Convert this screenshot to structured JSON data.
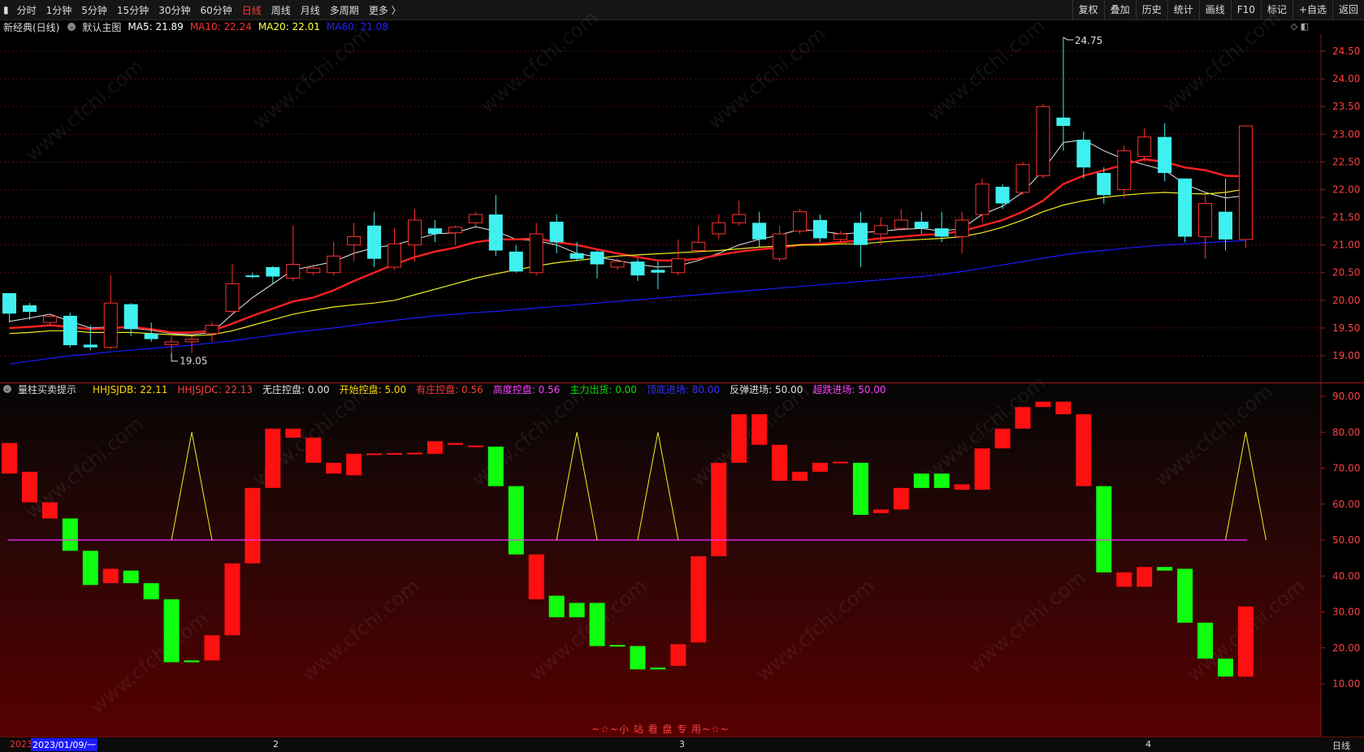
{
  "toolbar": {
    "periods": [
      "分时",
      "1分钟",
      "5分钟",
      "15分钟",
      "30分钟",
      "60分钟",
      "日线",
      "周线",
      "月线",
      "多周期",
      "更多 〉"
    ],
    "active_period": "日线",
    "right_buttons": [
      "复权",
      "叠加",
      "历史",
      "统计",
      "画线",
      "F10",
      "标记",
      "+自选",
      "返回"
    ]
  },
  "main_legend": {
    "name": "新经典(日线)",
    "template": "默认主图",
    "ma5": "MA5: 21.89",
    "ma10": "MA10: 22.24",
    "ma20": "MA20: 22.01",
    "ma60": "MA60: 21.08"
  },
  "main_axis": {
    "ticks": [
      "24.50",
      "24.00",
      "23.50",
      "23.00",
      "22.50",
      "22.00",
      "21.50",
      "21.00",
      "20.50",
      "20.00",
      "19.50",
      "19.00"
    ]
  },
  "annotations": {
    "high": "24.75",
    "low": "19.05"
  },
  "sub_legend": {
    "name": "量柱买卖提示",
    "items": [
      {
        "text": "HHJSJDB: 22.11",
        "color": "#ffd700"
      },
      {
        "text": "HHJSJDC: 22.13",
        "color": "#ff3c3c"
      },
      {
        "text": "无庄控盘: 0.00",
        "color": "#e0e0e0"
      },
      {
        "text": "开始控盘: 5.00",
        "color": "#ffd700"
      },
      {
        "text": "有庄控盘: 0.56",
        "color": "#ff3c3c"
      },
      {
        "text": "高度控盘: 0.56",
        "color": "#ff40ff"
      },
      {
        "text": "主力出货: 0.00",
        "color": "#00e000"
      },
      {
        "text": "顶底进场: 80.00",
        "color": "#3030ff"
      },
      {
        "text": "反弹进场: 50.00",
        "color": "#e0e0e0"
      },
      {
        "text": "超跌进场: 50.00",
        "color": "#ff40ff"
      }
    ]
  },
  "sub_axis": {
    "ticks": [
      "90.00",
      "80.00",
      "70.00",
      "60.00",
      "50.00",
      "40.00",
      "30.00",
      "20.00",
      "10.00"
    ]
  },
  "watermark": "www.cfchi.com",
  "footer_note": "~☆~小 站 看 盘 专 用~☆~",
  "xaxis": {
    "year_prefix": "2023",
    "cursor_date": "2023/01/09/一",
    "month_labels": [
      "2",
      "3",
      "4"
    ],
    "period_label": "日线"
  },
  "chart_data": {
    "type": "candlestick",
    "price_ylim": [
      18.8,
      24.85
    ],
    "candles": [
      {
        "o": 20.13,
        "c": 19.76,
        "h": 20.13,
        "l": 19.6
      },
      {
        "o": 19.91,
        "c": 19.79,
        "h": 19.95,
        "l": 19.65
      },
      {
        "o": 19.6,
        "c": 19.71,
        "h": 19.75,
        "l": 19.55
      },
      {
        "o": 19.72,
        "c": 19.19,
        "h": 19.78,
        "l": 19.15
      },
      {
        "o": 19.2,
        "c": 19.15,
        "h": 19.55,
        "l": 19.1
      },
      {
        "o": 19.15,
        "c": 19.95,
        "h": 20.45,
        "l": 19.12
      },
      {
        "o": 19.93,
        "c": 19.48,
        "h": 19.95,
        "l": 19.35
      },
      {
        "o": 19.4,
        "c": 19.3,
        "h": 19.6,
        "l": 19.25
      },
      {
        "o": 19.2,
        "c": 19.25,
        "h": 19.35,
        "l": 19.05
      },
      {
        "o": 19.25,
        "c": 19.3,
        "h": 19.35,
        "l": 19.05
      },
      {
        "o": 19.4,
        "c": 19.55,
        "h": 19.6,
        "l": 19.25
      },
      {
        "o": 19.8,
        "c": 20.3,
        "h": 20.65,
        "l": 19.75
      },
      {
        "o": 20.45,
        "c": 20.42,
        "h": 20.5,
        "l": 20.4
      },
      {
        "o": 20.6,
        "c": 20.43,
        "h": 20.62,
        "l": 20.3
      },
      {
        "o": 20.4,
        "c": 20.65,
        "h": 21.35,
        "l": 20.35
      },
      {
        "o": 20.5,
        "c": 20.58,
        "h": 20.65,
        "l": 20.45
      },
      {
        "o": 20.5,
        "c": 20.8,
        "h": 21.05,
        "l": 20.45
      },
      {
        "o": 21.0,
        "c": 21.15,
        "h": 21.4,
        "l": 20.7
      },
      {
        "o": 21.35,
        "c": 20.75,
        "h": 21.6,
        "l": 20.6
      },
      {
        "o": 20.6,
        "c": 21.02,
        "h": 21.3,
        "l": 20.55
      },
      {
        "o": 21.0,
        "c": 21.45,
        "h": 21.65,
        "l": 20.7
      },
      {
        "o": 21.3,
        "c": 21.2,
        "h": 21.45,
        "l": 21.05
      },
      {
        "o": 21.22,
        "c": 21.32,
        "h": 21.35,
        "l": 21.0
      },
      {
        "o": 21.4,
        "c": 21.55,
        "h": 21.6,
        "l": 21.3
      },
      {
        "o": 21.55,
        "c": 20.9,
        "h": 21.9,
        "l": 20.8
      },
      {
        "o": 20.88,
        "c": 20.52,
        "h": 21.0,
        "l": 20.5
      },
      {
        "o": 20.5,
        "c": 21.2,
        "h": 21.4,
        "l": 20.45
      },
      {
        "o": 21.42,
        "c": 21.05,
        "h": 21.55,
        "l": 20.85
      },
      {
        "o": 20.85,
        "c": 20.75,
        "h": 21.05,
        "l": 20.7
      },
      {
        "o": 20.88,
        "c": 20.65,
        "h": 20.9,
        "l": 20.4
      },
      {
        "o": 20.6,
        "c": 20.7,
        "h": 20.75,
        "l": 20.55
      },
      {
        "o": 20.7,
        "c": 20.45,
        "h": 20.75,
        "l": 20.35
      },
      {
        "o": 20.55,
        "c": 20.5,
        "h": 20.7,
        "l": 20.2
      },
      {
        "o": 20.5,
        "c": 20.75,
        "h": 21.1,
        "l": 20.45
      },
      {
        "o": 20.9,
        "c": 21.05,
        "h": 21.35,
        "l": 20.85
      },
      {
        "o": 21.2,
        "c": 21.4,
        "h": 21.55,
        "l": 21.1
      },
      {
        "o": 21.4,
        "c": 21.55,
        "h": 21.8,
        "l": 21.35
      },
      {
        "o": 21.4,
        "c": 21.1,
        "h": 21.6,
        "l": 20.95
      },
      {
        "o": 20.75,
        "c": 21.2,
        "h": 21.35,
        "l": 20.7
      },
      {
        "o": 21.25,
        "c": 21.6,
        "h": 21.65,
        "l": 21.2
      },
      {
        "o": 21.45,
        "c": 21.12,
        "h": 21.55,
        "l": 21.05
      },
      {
        "o": 21.1,
        "c": 21.2,
        "h": 21.25,
        "l": 21.05
      },
      {
        "o": 21.4,
        "c": 21.0,
        "h": 21.6,
        "l": 20.6
      },
      {
        "o": 21.2,
        "c": 21.35,
        "h": 21.5,
        "l": 21.0
      },
      {
        "o": 21.3,
        "c": 21.45,
        "h": 21.65,
        "l": 21.25
      },
      {
        "o": 21.42,
        "c": 21.3,
        "h": 21.6,
        "l": 21.2
      },
      {
        "o": 21.3,
        "c": 21.15,
        "h": 21.6,
        "l": 21.05
      },
      {
        "o": 21.15,
        "c": 21.45,
        "h": 21.6,
        "l": 20.85
      },
      {
        "o": 21.55,
        "c": 22.1,
        "h": 22.2,
        "l": 21.4
      },
      {
        "o": 22.05,
        "c": 21.75,
        "h": 22.1,
        "l": 21.65
      },
      {
        "o": 21.95,
        "c": 22.45,
        "h": 22.5,
        "l": 21.9
      },
      {
        "o": 22.25,
        "c": 23.5,
        "h": 23.55,
        "l": 22.2
      },
      {
        "o": 23.3,
        "c": 23.15,
        "h": 24.75,
        "l": 22.7
      },
      {
        "o": 22.9,
        "c": 22.4,
        "h": 23.05,
        "l": 22.2
      },
      {
        "o": 22.3,
        "c": 21.9,
        "h": 22.4,
        "l": 21.75
      },
      {
        "o": 22.0,
        "c": 22.7,
        "h": 22.8,
        "l": 21.85
      },
      {
        "o": 22.6,
        "c": 22.95,
        "h": 23.1,
        "l": 22.5
      },
      {
        "o": 22.95,
        "c": 22.3,
        "h": 23.2,
        "l": 22.15
      },
      {
        "o": 22.2,
        "c": 21.15,
        "h": 22.2,
        "l": 21.05
      },
      {
        "o": 21.15,
        "c": 21.75,
        "h": 21.9,
        "l": 20.75
      },
      {
        "o": 21.6,
        "c": 21.1,
        "h": 22.2,
        "l": 20.9
      },
      {
        "o": 21.1,
        "c": 23.15,
        "h": 23.15,
        "l": 20.95
      }
    ],
    "ma_series": {
      "MA5": [
        19.62,
        19.68,
        19.75,
        19.62,
        19.5,
        19.52,
        19.5,
        19.46,
        19.4,
        19.38,
        19.42,
        19.75,
        20.05,
        20.3,
        20.55,
        20.62,
        20.7,
        20.85,
        20.95,
        21.0,
        21.1,
        21.2,
        21.22,
        21.33,
        21.25,
        21.1,
        21.08,
        21.0,
        20.85,
        20.78,
        20.72,
        20.65,
        20.6,
        20.62,
        20.72,
        20.85,
        21.0,
        21.1,
        21.18,
        21.28,
        21.25,
        21.2,
        21.22,
        21.25,
        21.28,
        21.3,
        21.25,
        21.3,
        21.55,
        21.7,
        21.95,
        22.35,
        22.85,
        22.9,
        22.7,
        22.55,
        22.45,
        22.35,
        22.1,
        21.95,
        21.85,
        21.89
      ],
      "MA10": [
        19.5,
        19.52,
        19.55,
        19.52,
        19.48,
        19.5,
        19.52,
        19.48,
        19.42,
        19.42,
        19.45,
        19.58,
        19.72,
        19.85,
        19.98,
        20.05,
        20.18,
        20.35,
        20.5,
        20.65,
        20.78,
        20.88,
        20.95,
        21.05,
        21.1,
        21.1,
        21.12,
        21.05,
        21.0,
        20.92,
        20.85,
        20.78,
        20.72,
        20.72,
        20.75,
        20.82,
        20.88,
        20.92,
        20.95,
        21.0,
        21.02,
        21.05,
        21.08,
        21.12,
        21.15,
        21.18,
        21.2,
        21.25,
        21.35,
        21.45,
        21.6,
        21.8,
        22.1,
        22.25,
        22.35,
        22.45,
        22.55,
        22.5,
        22.4,
        22.35,
        22.25,
        22.24
      ],
      "MA20": [
        19.4,
        19.42,
        19.45,
        19.45,
        19.42,
        19.42,
        19.42,
        19.4,
        19.38,
        19.36,
        19.38,
        19.45,
        19.55,
        19.65,
        19.75,
        19.82,
        19.88,
        19.92,
        19.95,
        20.0,
        20.1,
        20.2,
        20.3,
        20.4,
        20.48,
        20.55,
        20.62,
        20.68,
        20.72,
        20.76,
        20.8,
        20.82,
        20.84,
        20.86,
        20.88,
        20.9,
        20.93,
        20.96,
        20.98,
        21.0,
        21.0,
        21.02,
        21.02,
        21.05,
        21.08,
        21.1,
        21.12,
        21.15,
        21.22,
        21.32,
        21.45,
        21.6,
        21.72,
        21.8,
        21.86,
        21.9,
        21.93,
        21.95,
        21.93,
        21.92,
        21.95,
        22.01
      ],
      "MA60": [
        18.85,
        18.9,
        18.95,
        19.0,
        19.03,
        19.07,
        19.1,
        19.13,
        19.16,
        19.19,
        19.23,
        19.27,
        19.32,
        19.37,
        19.42,
        19.46,
        19.5,
        19.55,
        19.6,
        19.64,
        19.68,
        19.72,
        19.75,
        19.78,
        19.8,
        19.83,
        19.86,
        19.89,
        19.92,
        19.95,
        19.98,
        20.01,
        20.04,
        20.07,
        20.1,
        20.13,
        20.16,
        20.19,
        20.22,
        20.25,
        20.28,
        20.31,
        20.34,
        20.37,
        20.4,
        20.43,
        20.47,
        20.52,
        20.58,
        20.64,
        20.7,
        20.76,
        20.82,
        20.87,
        20.9,
        20.94,
        20.97,
        21.0,
        21.02,
        21.04,
        21.06,
        21.08
      ]
    },
    "sub_ylim": [
      0,
      92
    ],
    "sub_bars": [
      [
        68.5,
        77.0
      ],
      [
        60.5,
        69.0
      ],
      [
        56.0,
        60.5
      ],
      [
        47.0,
        56.0
      ],
      [
        37.5,
        47.0
      ],
      [
        38.0,
        42.0
      ],
      [
        38.0,
        41.5
      ],
      [
        33.5,
        38.0
      ],
      [
        16.0,
        33.5
      ],
      [
        16.0,
        16.5
      ],
      [
        16.5,
        23.5
      ],
      [
        23.5,
        43.5
      ],
      [
        43.5,
        64.5
      ],
      [
        64.5,
        81.0
      ],
      [
        78.5,
        81.0
      ],
      [
        71.5,
        78.5
      ],
      [
        68.5,
        71.5
      ],
      [
        68.0,
        74.0
      ],
      [
        74.0,
        74.1
      ],
      [
        74.0,
        74.2
      ],
      [
        74.0,
        74.3
      ],
      [
        74.0,
        77.5
      ],
      [
        76.5,
        77.0
      ],
      [
        76.0,
        76.3
      ],
      [
        65.0,
        76.0
      ],
      [
        46.0,
        65.0
      ],
      [
        33.5,
        46.0
      ],
      [
        28.5,
        34.5
      ],
      [
        28.5,
        32.5
      ],
      [
        20.5,
        32.5
      ],
      [
        20.5,
        20.8
      ],
      [
        14.0,
        20.5
      ],
      [
        14.0,
        14.5
      ],
      [
        15.0,
        21.0
      ],
      [
        21.5,
        45.5
      ],
      [
        45.5,
        71.5
      ],
      [
        71.5,
        85.0
      ],
      [
        76.5,
        85.0
      ],
      [
        66.5,
        76.5
      ],
      [
        66.5,
        69.0
      ],
      [
        69.0,
        71.5
      ],
      [
        71.5,
        71.8
      ],
      [
        57.0,
        71.5
      ],
      [
        57.5,
        58.5
      ],
      [
        58.5,
        64.5
      ],
      [
        64.5,
        68.5
      ],
      [
        64.5,
        68.5
      ],
      [
        64.0,
        65.5
      ],
      [
        64.0,
        75.5
      ],
      [
        75.5,
        81.0
      ],
      [
        81.0,
        87.0
      ],
      [
        87.0,
        88.5
      ],
      [
        85.0,
        88.5
      ],
      [
        65.0,
        85.0
      ],
      [
        41.0,
        65.0
      ],
      [
        37.0,
        41.0
      ],
      [
        37.0,
        42.5
      ],
      [
        41.5,
        42.5
      ],
      [
        27.0,
        42.0
      ],
      [
        17.0,
        27.0
      ],
      [
        12.0,
        17.0
      ],
      [
        12.0,
        31.5
      ]
    ],
    "sub_bar_up": [
      1,
      1,
      1,
      0,
      0,
      1,
      0,
      0,
      0,
      0,
      1,
      1,
      1,
      1,
      1,
      1,
      1,
      1,
      1,
      1,
      1,
      1,
      1,
      1,
      0,
      0,
      1,
      0,
      0,
      0,
      0,
      0,
      0,
      1,
      1,
      1,
      1,
      1,
      1,
      1,
      1,
      1,
      0,
      1,
      1,
      0,
      0,
      1,
      1,
      1,
      1,
      1,
      1,
      1,
      0,
      1,
      1,
      0,
      0,
      0,
      0,
      1
    ],
    "reference_line": 50,
    "signal_spikes": [
      {
        "index": 9,
        "value": 80
      },
      {
        "index": 28,
        "value": 80
      },
      {
        "index": 32,
        "value": 80
      },
      {
        "index": 61,
        "value": 80
      }
    ]
  }
}
